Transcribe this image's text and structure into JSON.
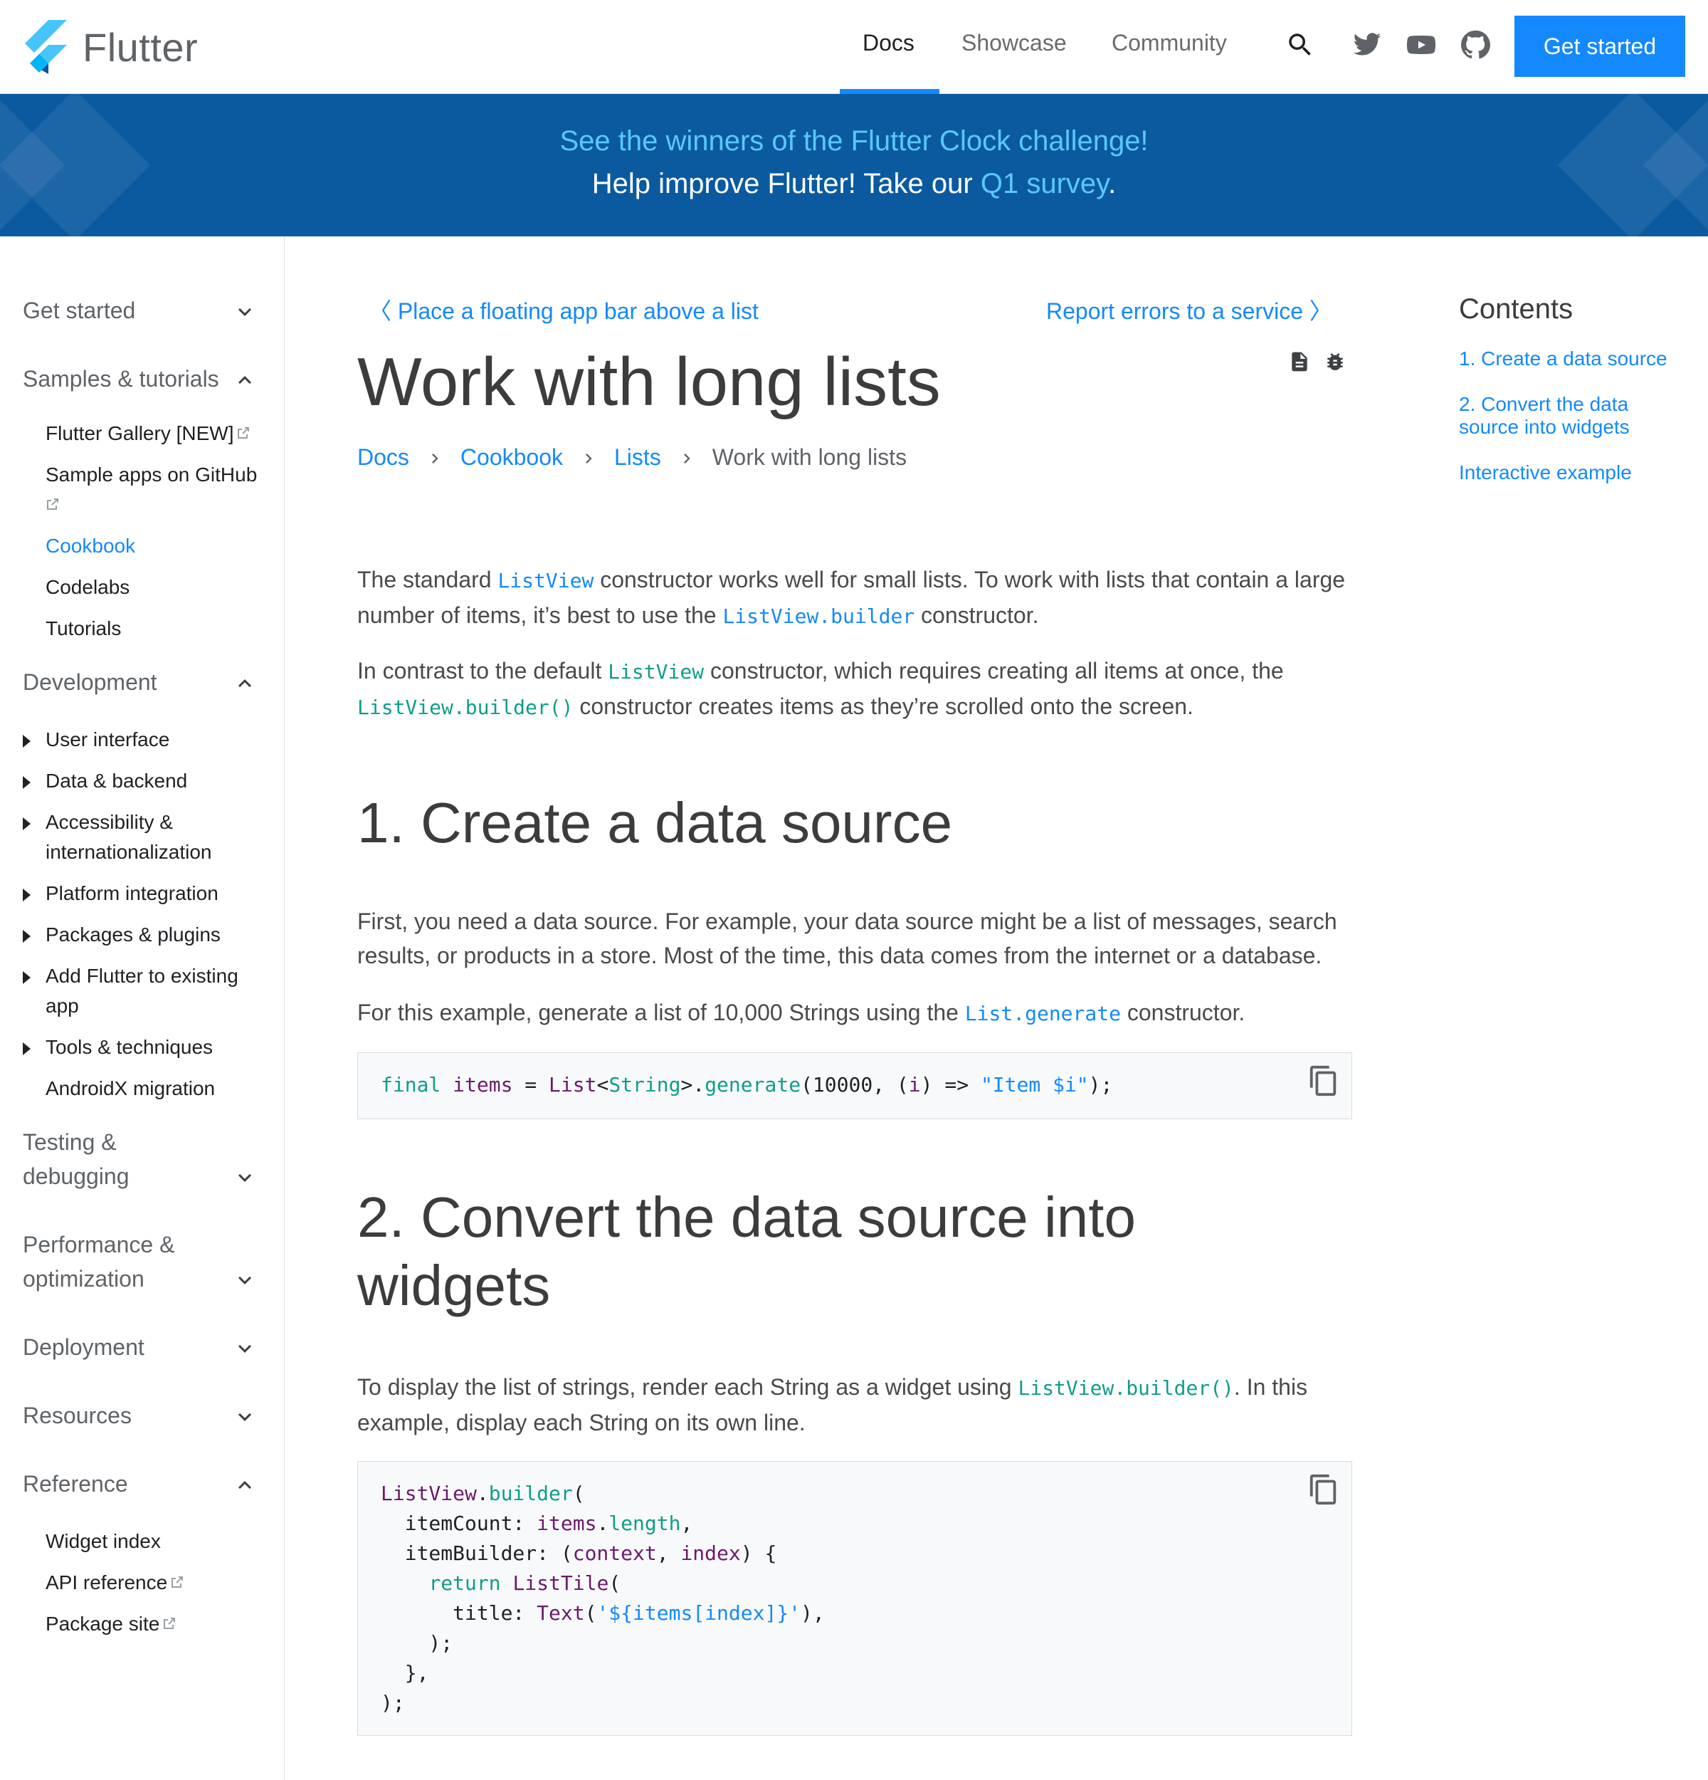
{
  "header": {
    "brand": "Flutter",
    "nav": [
      {
        "label": "Docs",
        "active": true
      },
      {
        "label": "Showcase",
        "active": false
      },
      {
        "label": "Community",
        "active": false
      }
    ],
    "icons": [
      "search-icon",
      "twitter-icon",
      "youtube-icon",
      "github-icon"
    ],
    "cta": "Get started"
  },
  "banner": {
    "line1": "See the winners of the Flutter Clock challenge!",
    "line2_prefix": "Help improve Flutter! Take our ",
    "line2_link": "Q1 survey",
    "line2_suffix": "."
  },
  "sidebar": {
    "get_started": "Get started",
    "samples": "Samples & tutorials",
    "samples_items": [
      "Flutter Gallery [NEW]",
      "Sample apps on GitHub",
      "Cookbook",
      "Codelabs",
      "Tutorials"
    ],
    "development": "Development",
    "development_items": [
      "User interface",
      "Data & backend",
      "Accessibility &",
      "internationalization",
      "Platform integration",
      "Packages & plugins",
      "Add Flutter to existing",
      "app",
      "Tools & techniques",
      "AndroidX migration"
    ],
    "testing_1": "Testing &",
    "testing_2": "debugging",
    "perf_1": "Performance &",
    "perf_2": "optimization",
    "deployment": "Deployment",
    "resources": "Resources",
    "reference": "Reference",
    "reference_items": [
      "Widget index",
      "API reference",
      "Package site"
    ]
  },
  "main": {
    "prev_link": "Place a floating app bar above a list",
    "next_link": "Report errors to a service",
    "title": "Work with long lists",
    "breadcrumbs": [
      "Docs",
      "Cookbook",
      "Lists",
      "Work with long lists"
    ],
    "p1_a": "The standard ",
    "p1_code1": "ListView",
    "p1_b": " constructor works well for small lists. To work with lists that contain a large number of items, it’s best to use the ",
    "p1_code2": "ListView.builder",
    "p1_c": " constructor.",
    "p2_a": "In contrast to the default ",
    "p2_code1": "ListView",
    "p2_b": " constructor, which requires creating all items at once, the ",
    "p2_code2": "ListView.builder()",
    "p2_c": " constructor creates items as they’re scrolled onto the screen.",
    "h2_1": "1. Create a data source",
    "p3": "First, you need a data source. For example, your data source might be a list of messages, search results, or products in a store. Most of the time, this data comes from the internet or a database.",
    "p4_a": "For this example, generate a list of 10,000 Strings using the ",
    "p4_code": "List.generate",
    "p4_b": " constructor.",
    "code1": {
      "kw_final": "final",
      "var_items": "items",
      "eq": " = ",
      "list": "List",
      "lt": "<",
      "string": "String",
      "gt_dot": ">.",
      "generate": "generate",
      "args_a": "(10000, (",
      "i": "i",
      "args_b": ") => ",
      "str": "\"Item $i\"",
      "end": ");"
    },
    "h2_2_l1": "2. Convert the data source into",
    "h2_2_l2": "widgets",
    "p5_a": "To display the list of strings, render each String as a widget using ",
    "p5_code": "ListView.builder()",
    "p5_b": ". In this example, display each String on its own line.",
    "code2": {
      "l1_a": "ListView",
      "l1_b": ".",
      "l1_c": "builder",
      "l1_d": "(",
      "l2_a": "  itemCount: ",
      "l2_b": "items",
      "l2_c": ".",
      "l2_d": "length",
      "l2_e": ",",
      "l3_a": "  itemBuilder: (",
      "l3_b": "context",
      "l3_c": ", ",
      "l3_d": "index",
      "l3_e": ") {",
      "l4_a": "    ",
      "l4_b": "return",
      "l4_c": " ",
      "l4_d": "ListTile",
      "l4_e": "(",
      "l5_a": "      title: ",
      "l5_b": "Text",
      "l5_c": "(",
      "l5_d": "'${items[index]}'",
      "l5_e": "),",
      "l6": "    );",
      "l7": "  },",
      "l8": ");"
    }
  },
  "toc": {
    "title": "Contents",
    "links": [
      "1. Create a data source",
      "2. Convert the data",
      "source into widgets",
      "Interactive example"
    ]
  },
  "colors": {
    "accent": "#1389fd",
    "banner_bg": "#0b5aa0",
    "banner_link": "#5ac8fa",
    "code_teal": "#0f9d8a",
    "code_purple": "#6b1a6b"
  }
}
